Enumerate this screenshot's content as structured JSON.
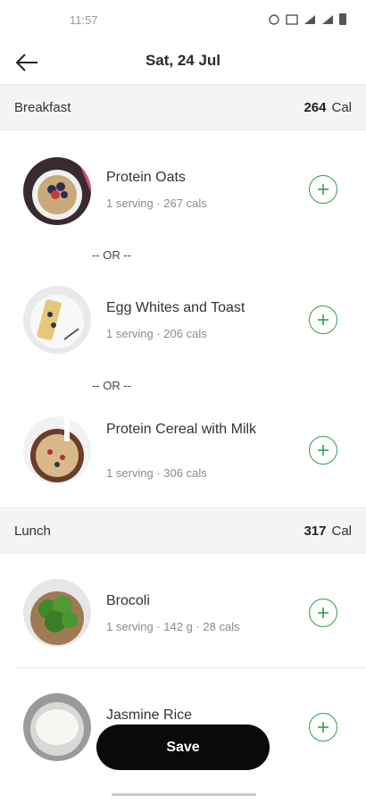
{
  "status": {
    "time": "11:57"
  },
  "header": {
    "title": "Sat, 24 Jul"
  },
  "breakfast": {
    "name": "Breakfast",
    "cal_value": "264",
    "cal_unit": "Cal",
    "items": [
      {
        "name": "Protein Oats",
        "meta": "1 serving · 267 cals"
      },
      {
        "name": "Egg Whites and Toast",
        "meta": "1 serving · 206 cals"
      },
      {
        "name": "Protein Cereal with Milk",
        "meta": "1 serving · 306 cals"
      }
    ],
    "or_label": "-- OR --"
  },
  "lunch": {
    "name": "Lunch",
    "cal_value": "317",
    "cal_unit": "Cal",
    "items": [
      {
        "name": "Brocoli",
        "meta": "1 serving · 142 g · 28 cals"
      },
      {
        "name": "Jasmine Rice",
        "meta": ""
      }
    ]
  },
  "footer": {
    "save_label": "Save"
  },
  "colors": {
    "accent": "#2e9e4d",
    "button": "#0a0a0a"
  }
}
